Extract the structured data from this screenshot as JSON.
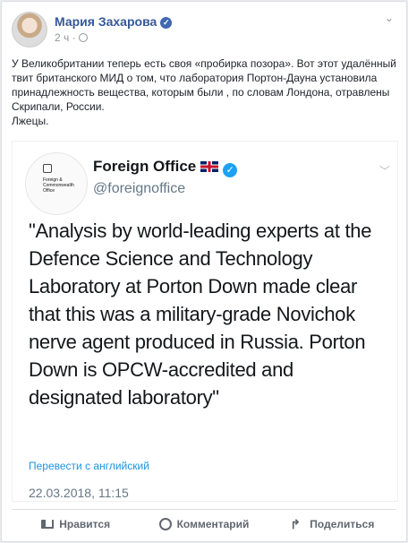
{
  "post": {
    "author": "Мария Захарова",
    "time": "2 ч",
    "text": "У Великобритании теперь есть своя «пробирка позора». Вот этот удалённый твит британского МИД о том, что лаборатория Портон-Дауна установила принадлежность вещества, которым были , по словам Лондона, отравлены Скрипали, России.\nЛжецы."
  },
  "tweet": {
    "logo_text": "Foreign &\nCommonwealth\nOffice",
    "name": "Foreign Office",
    "handle": "@foreignoffice",
    "text": "\"Analysis by world-leading experts at the Defence Science and Technology Laboratory at Porton Down made clear that this was a military-grade Novichok nerve agent produced in Russia. Porton Down is OPCW-accredited and designated laboratory\"",
    "translate": "Перевести с английский",
    "date": "22.03.2018, 11:15"
  },
  "actions": {
    "like": "Нравится",
    "comment": "Комментарий",
    "share": "Поделиться"
  },
  "icons": {
    "verified": "verified-badge-icon",
    "globe": "globe-icon",
    "menu": "chevron-down-icon"
  },
  "colors": {
    "link": "#365899",
    "twitter_blue": "#1da1f2",
    "flag_blue": "#012169",
    "flag_red": "#c8102e"
  }
}
